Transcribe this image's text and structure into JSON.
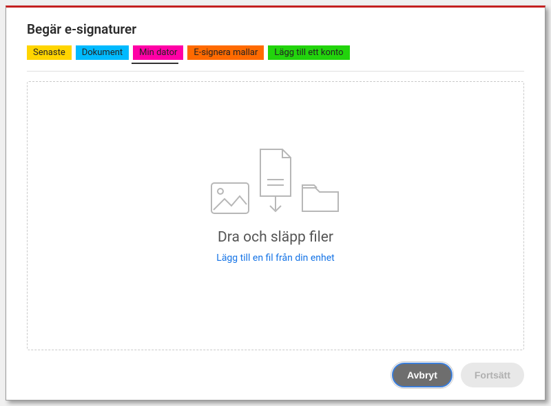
{
  "dialog": {
    "title": "Begär e-signaturer"
  },
  "tabs": [
    {
      "label": "Senaste",
      "bg": "#ffd500",
      "active": false
    },
    {
      "label": "Dokument",
      "bg": "#00baff",
      "active": false
    },
    {
      "label": "Min dator",
      "bg": "#ff00a6",
      "active": true
    },
    {
      "label": "E-signera mallar",
      "bg": "#ff6a00",
      "active": false
    },
    {
      "label": "Lägg till ett konto",
      "bg": "#22d40c",
      "active": false
    }
  ],
  "dropzone": {
    "title": "Dra och släpp filer",
    "link": "Lägg till en fil från din enhet"
  },
  "buttons": {
    "cancel": "Avbryt",
    "continue": "Fortsätt"
  }
}
